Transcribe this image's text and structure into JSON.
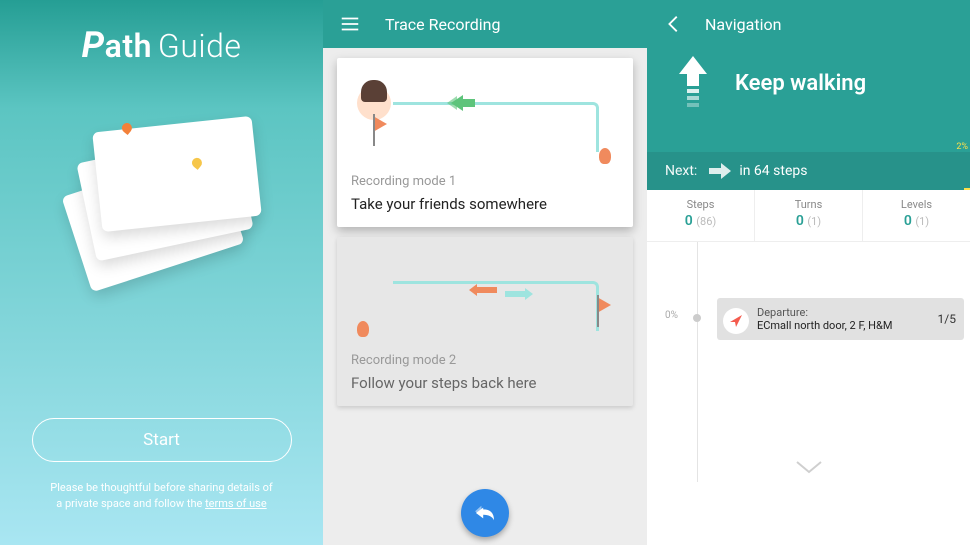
{
  "screen1": {
    "logo_p": "P",
    "logo_ath": "ath",
    "logo_guide": "Guide",
    "start": "Start",
    "disclaimer_a": "Please be thoughtful before sharing details of",
    "disclaimer_b": "a private space and follow the ",
    "terms": "terms of use"
  },
  "screen2": {
    "title": "Trace Recording",
    "mode1_label": "Recording mode 1",
    "mode1_title": "Take your friends somewhere",
    "mode2_label": "Recording mode 2",
    "mode2_title": "Follow your steps back here"
  },
  "screen3": {
    "title": "Navigation",
    "instruction": "Keep walking",
    "next_label": "Next:",
    "next_text": "in 64 steps",
    "progress_pct": "2%",
    "stats": {
      "steps_label": "Steps",
      "steps_cur": "0",
      "steps_total": "(86)",
      "turns_label": "Turns",
      "turns_cur": "0",
      "turns_total": "(1)",
      "levels_label": "Levels",
      "levels_cur": "0",
      "levels_total": "(1)"
    },
    "timeline_pct": "0%",
    "departure_label": "Departure:",
    "departure_text": "ECmall north door, 2 F, H&M",
    "departure_counter": "1/5"
  }
}
